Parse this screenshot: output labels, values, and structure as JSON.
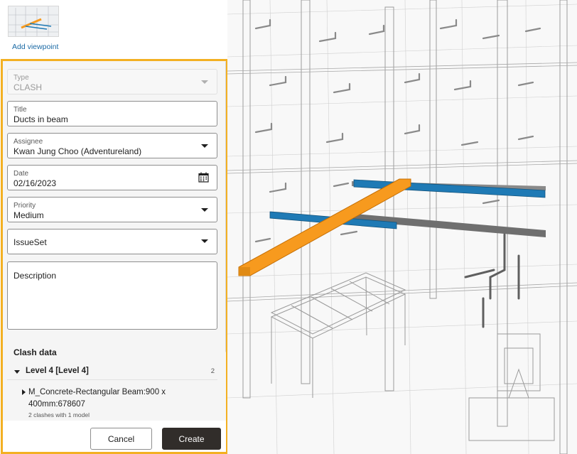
{
  "viewpoint": {
    "add_label": "Add viewpoint"
  },
  "form": {
    "type": {
      "label": "Type",
      "value": "CLASH"
    },
    "title": {
      "label": "Title",
      "value": "Ducts in beam"
    },
    "assignee": {
      "label": "Assignee",
      "value": "Kwan Jung Choo (Adventureland)"
    },
    "date": {
      "label": "Date",
      "value": "02/16/2023"
    },
    "priority": {
      "label": "Priority",
      "value": "Medium"
    },
    "issue_set": {
      "placeholder": "IssueSet"
    },
    "description": {
      "label": "Description"
    }
  },
  "clash_data": {
    "heading": "Clash data",
    "level": {
      "label": "Level 4 [Level 4]",
      "count": "2"
    },
    "element": {
      "name": "M_Concrete-Rectangular Beam:900 x 400mm:678607",
      "summary": "2 clashes with 1 model"
    }
  },
  "footer": {
    "cancel_label": "Cancel",
    "create_label": "Create"
  },
  "colors": {
    "highlight_border": "#f3b022",
    "beam_orange": "#f79a1e",
    "duct_blue": "#1f7ab5",
    "create_button": "#312d2a",
    "link": "#1b6aa5"
  }
}
